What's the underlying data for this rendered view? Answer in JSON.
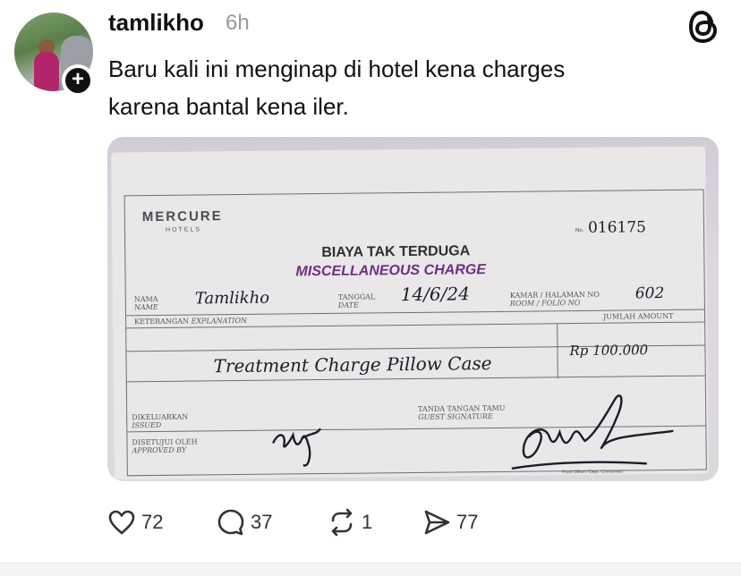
{
  "post": {
    "username": "tamlikho",
    "time": "6h",
    "text_lines": [
      "Baru kali ini menginap di hotel kena charges",
      "karena bantal kena iler."
    ]
  },
  "receipt": {
    "brand": "MERCURE",
    "brand_sub": "HOTELS",
    "no_label": "No.",
    "serial": "016175",
    "title_id": "BIAYA TAK TERDUGA",
    "title_en": "MISCELLANEOUS CHARGE",
    "labels": {
      "nama": "NAMA",
      "name": "NAME",
      "tanggal": "TANGGAL",
      "date": "DATE",
      "kamar": "KAMAR / HALAMAN NO",
      "room": "ROOM / FOLIO NO",
      "keterangan": "KETERANGAN",
      "explanation": "EXPLANATION",
      "jumlah": "JUMLAH AMOUNT",
      "dikeluarkan": "DIKELUARKAN",
      "issued": "ISSUED",
      "disetujui": "DISETUJUI OLEH",
      "approved": "APPROVED BY",
      "tanda": "TANDA TANGAN TAMU",
      "guest_sig": "GUEST SIGNATURE"
    },
    "handwritten": {
      "name": "Tamlikho",
      "date": "14/6/24",
      "room": "602",
      "explanation": "Treatment Charge Pillow Case",
      "amount": "Rp 100.000"
    },
    "footer": "Front Office / Dept. Concerned"
  },
  "actions": {
    "likes": "72",
    "replies": "37",
    "reposts": "1",
    "shares": "77"
  },
  "icons": [
    "avatar",
    "plus-icon",
    "threads-logo-icon",
    "heart-icon",
    "comment-icon",
    "repost-icon",
    "share-icon"
  ]
}
